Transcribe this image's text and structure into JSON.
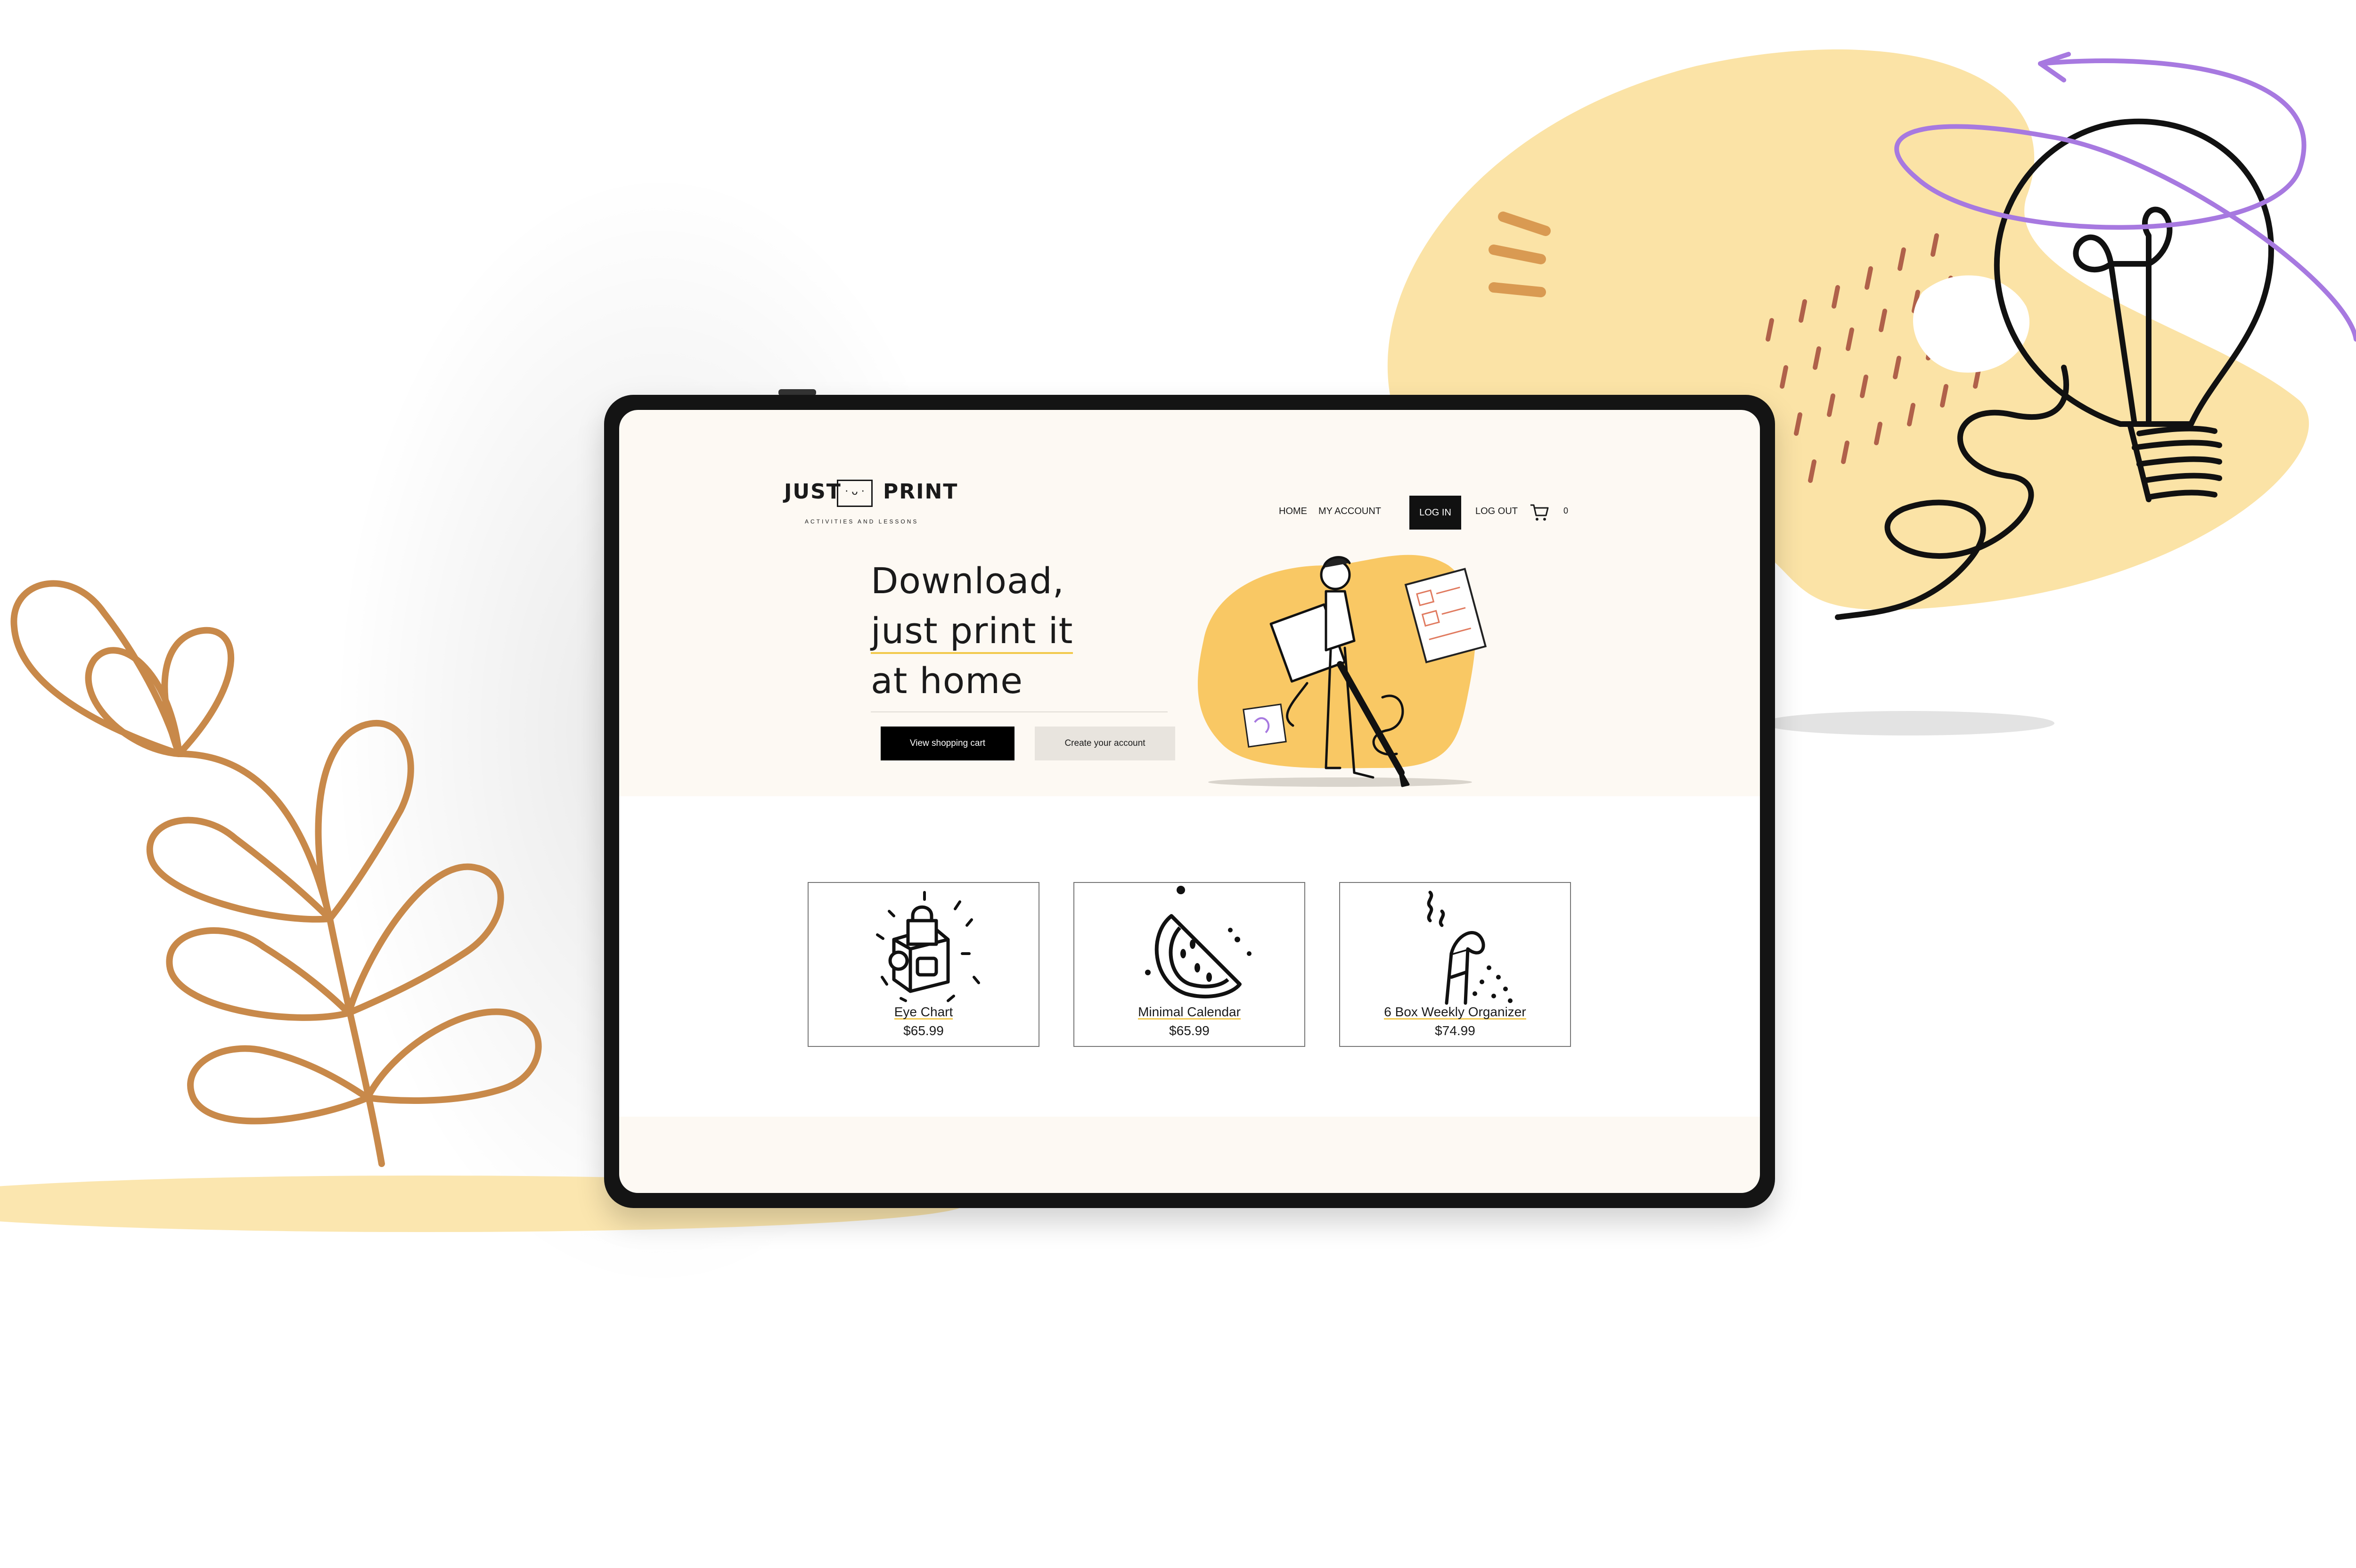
{
  "brand": {
    "name_left": "JUST",
    "face": "· ᴗ ·",
    "name_right": "PRINT",
    "tagline": "ACTIVITIES AND LESSONS"
  },
  "nav": {
    "home": "HOME",
    "my_account": "MY ACCOUNT",
    "log_in": "LOG IN",
    "log_out": "LOG OUT",
    "cart_count": "0"
  },
  "hero": {
    "line1": "Download,",
    "line2": "just print it",
    "line3": "at home",
    "primary_button": "View shopping cart",
    "secondary_button": "Create your account"
  },
  "products": [
    {
      "name": "Eye Chart",
      "price": "$65.99",
      "icon": "robot-lock-icon"
    },
    {
      "name": "Minimal Calendar",
      "price": "$65.99",
      "icon": "watermelon-icon"
    },
    {
      "name": "6 Box Weekly Organizer",
      "price": "$74.99",
      "icon": "pencil-hand-icon"
    }
  ],
  "colors": {
    "accent_yellow": "#f2c94c",
    "blob_yellow": "#fbe3a6",
    "leaf_orange": "#c8894a",
    "bulb_purple": "#a779e0",
    "screen_bg": "#fdf9f3",
    "dark": "#111111"
  }
}
